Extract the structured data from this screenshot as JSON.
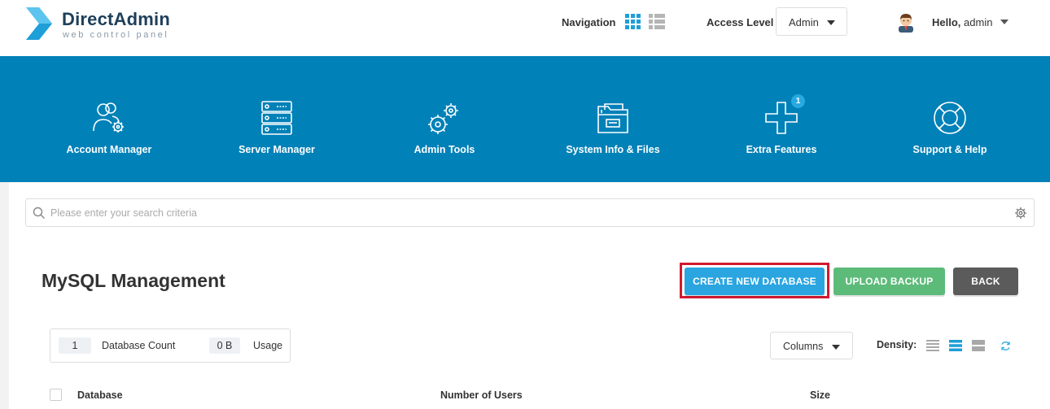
{
  "header": {
    "logo": {
      "title": "DirectAdmin",
      "subtitle": "web control panel"
    },
    "navigation_label": "Navigation",
    "access_level": {
      "label": "Access Level",
      "value": "Admin"
    },
    "user": {
      "greeting": "Hello,",
      "name": "admin"
    }
  },
  "main_nav": [
    {
      "label": "Account Manager",
      "icon": "account-manager-icon"
    },
    {
      "label": "Server Manager",
      "icon": "server-manager-icon"
    },
    {
      "label": "Admin Tools",
      "icon": "admin-tools-icon"
    },
    {
      "label": "System Info & Files",
      "icon": "folder-icon"
    },
    {
      "label": "Extra Features",
      "icon": "plus-icon",
      "badge": "1"
    },
    {
      "label": "Support & Help",
      "icon": "lifebuoy-icon"
    }
  ],
  "search": {
    "placeholder": "Please enter your search criteria"
  },
  "page": {
    "title": "MySQL Management",
    "buttons": {
      "create": "CREATE NEW DATABASE",
      "upload": "UPLOAD BACKUP",
      "back": "BACK"
    }
  },
  "stats": {
    "count_value": "1",
    "count_label": "Database Count",
    "usage_value": "0 B",
    "usage_label": "Usage"
  },
  "table_controls": {
    "columns_label": "Columns",
    "density_label": "Density:"
  },
  "table": {
    "headers": [
      "Database",
      "Number of Users",
      "Size"
    ]
  },
  "colors": {
    "band": "#0081b8",
    "create_button": "#2aa5e0",
    "upload_button": "#5dbb7a",
    "back_button": "#5b5b5b",
    "highlight_outline": "#d3192f"
  }
}
